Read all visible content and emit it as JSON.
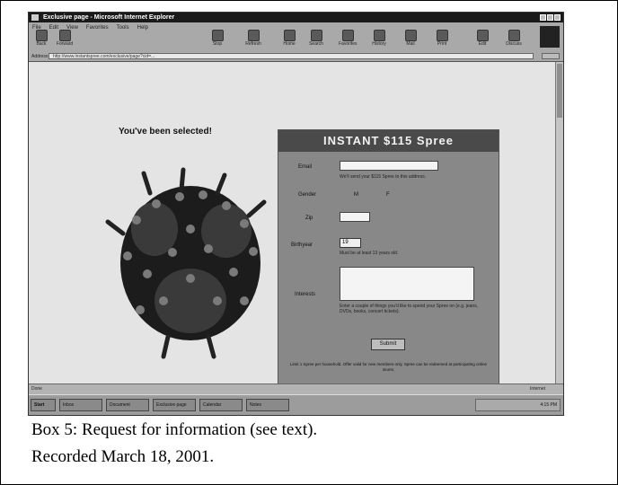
{
  "window": {
    "title": "Exclusive page - Microsoft Internet Explorer"
  },
  "menu": [
    "File",
    "Edit",
    "View",
    "Favorites",
    "Tools",
    "Help"
  ],
  "toolbar": [
    "Back",
    "Forward",
    "Stop",
    "Refresh",
    "Home",
    "Search",
    "Favorites",
    "History",
    "Mail",
    "Print",
    "Edit",
    "Discuss"
  ],
  "address": {
    "label": "Address",
    "url": "http://www.instantspree.com/exclusive/page?cid=..."
  },
  "page": {
    "headline": "You've been selected!",
    "form": {
      "title": "INSTANT $115 Spree",
      "email_label": "Email",
      "email_hint": "We'll send your $115 Spree to this address.",
      "gender_label": "Gender",
      "gender_m": "M",
      "gender_f": "F",
      "zip_label": "Zip",
      "birthyear_label": "Birthyear",
      "birthyear_value": "19",
      "birthyear_hint": "Must be at least 13 years old.",
      "interests_label": "Interests",
      "interests_hint": "Enter a couple of things you'd like to spend your Spree on (e.g. jeans, DVDs, books, concert tickets).",
      "submit_label": "Submit",
      "fine_print": "Limit 1 Spree per household. Offer valid for new members only. Spree can be redeemed at participating online stores."
    },
    "footer": "Copyright 2001 Instant Spree. All rights reserved. Privacy Policy. Terms and Conditions. Offer valid for a limited time only."
  },
  "status": {
    "left": "Done",
    "right": "Internet"
  },
  "taskbar": {
    "start": "Start",
    "items": [
      "Inbox",
      "Document",
      "Exclusive page",
      "Calendar",
      "Notes"
    ],
    "clock": "4:15 PM"
  },
  "caption": {
    "line1": "Box 5: Request for information (see text).",
    "line2": "Recorded March 18, 2001."
  }
}
